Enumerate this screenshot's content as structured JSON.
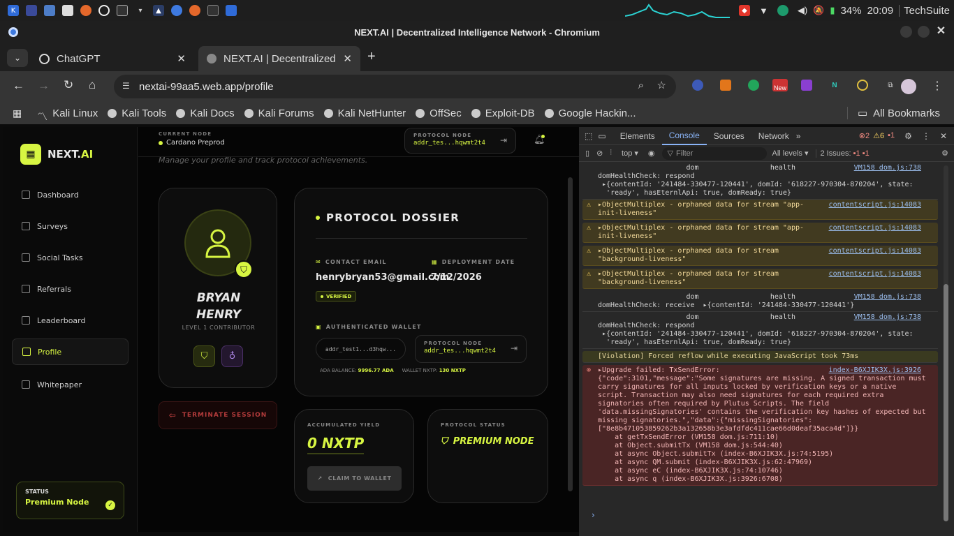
{
  "system": {
    "battery": "34%",
    "clock": "20:09",
    "user": "TechSuite"
  },
  "window": {
    "title": "NEXT.AI | Decentralized Intelligence Network - Chromium"
  },
  "tabs": [
    {
      "label": "ChatGPT"
    },
    {
      "label": "NEXT.AI | Decentralized I"
    }
  ],
  "address": {
    "url": "nextai-99aa5.web.app/profile"
  },
  "toolbar_ext": {
    "new_badge": "New"
  },
  "bookmarks": {
    "items": [
      "Kali Linux",
      "Kali Tools",
      "Kali Docs",
      "Kali Forums",
      "Kali NetHunter",
      "OffSec",
      "Exploit-DB",
      "Google Hackin..."
    ],
    "all": "All Bookmarks"
  },
  "app": {
    "brand": "NEXT.",
    "brand_accent": "AI",
    "nav": [
      "Dashboard",
      "Surveys",
      "Social Tasks",
      "Referrals",
      "Leaderboard",
      "Profile",
      "Whitepaper"
    ],
    "status_label": "STATUS",
    "status_value": "Premium Node",
    "current_node_label": "CURRENT NODE",
    "current_node": "Cardano Preprod",
    "protocol_node_label": "PROTOCOL NODE",
    "protocol_node_addr": "addr_tes...hqwmt2t4",
    "subtitle": "Manage your profile and track protocol achievements.",
    "user_first": "BRYAN",
    "user_last": "HENRY",
    "level": "LEVEL 1 CONTRIBUTOR",
    "terminate": "TERMINATE SESSION",
    "dossier_title": "PROTOCOL DOSSIER",
    "contact_label": "CONTACT EMAIL",
    "contact_value": "henrybryan53@gmail.com",
    "deploy_label": "DEPLOYMENT DATE",
    "deploy_value": "7/12/2026",
    "verified": "VERIFIED",
    "wallet_label": "AUTHENTICATED WALLET",
    "wallet_addr": "addr_test1...d3hqw...",
    "wallet_node_label": "PROTOCOL NODE",
    "wallet_node_addr": "addr_tes...hqwmt2t4",
    "ada_label": "ADA BALANCE:",
    "ada_value": "9996.77 ADA",
    "nxtp_label": "WALLET NXTP:",
    "nxtp_value": "130 NXTP",
    "yield_label": "ACCUMULATED YIELD",
    "yield_value": "0 NXTP",
    "claim": "CLAIM TO WALLET",
    "pstatus_label": "PROTOCOL STATUS",
    "pstatus_value": "PREMIUM NODE"
  },
  "devtools": {
    "tabs": [
      "Elements",
      "Console",
      "Sources",
      "Network"
    ],
    "errors": "2",
    "warnings": "6",
    "info": "1",
    "context": "top",
    "filter_placeholder": "Filter",
    "levels": "All levels",
    "issues": "2 Issues:",
    "issues_err": "1",
    "issues_info": "1"
  },
  "console": [
    {
      "type": "log",
      "text": "                     dom                 health\ndomHealthCheck: respond\n ▸{contentId: '241484-330477-120441', domId: '618227-970304-870204', state:\n  'ready', hasEternlApi: true, domReady: true}",
      "src": "VM158 dom.js:738"
    },
    {
      "type": "warn",
      "text": "▸ObjectMultiplex - orphaned data for stream \"app-\ninit-liveness\"",
      "src": "contentscript.js:14083"
    },
    {
      "type": "warn",
      "text": "▸ObjectMultiplex - orphaned data for stream \"app-\ninit-liveness\"",
      "src": "contentscript.js:14083"
    },
    {
      "type": "warn",
      "text": "▸ObjectMultiplex - orphaned data for stream\n\"background-liveness\"",
      "src": "contentscript.js:14083"
    },
    {
      "type": "warn",
      "text": "▸ObjectMultiplex - orphaned data for stream\n\"background-liveness\"",
      "src": "contentscript.js:14083"
    },
    {
      "type": "log",
      "text": "                     dom                 health\ndomHealthCheck: receive  ▸{contentId: '241484-330477-120441'}",
      "src": "VM158 dom.js:738"
    },
    {
      "type": "log",
      "text": "                     dom                 health\ndomHealthCheck: respond\n ▸{contentId: '241484-330477-120441', domId: '618227-970304-870204', state:\n  'ready', hasEternlApi: true, domReady: true}",
      "src": "VM158 dom.js:738"
    },
    {
      "type": "violation",
      "text": "[Violation] Forced reflow while executing JavaScript took 73ms",
      "src": ""
    },
    {
      "type": "err",
      "text": "▸Upgrade failed: TxSendError:\n{\"code\":3101,\"message\":\"Some signatures are missing. A signed transaction must\ncarry signatures for all inputs locked by verification keys or a native\nscript. Transaction may also need signatures for each required extra\nsignatories often required by Plutus Scripts. The field\n'data.missingSignatories' contains the verification key hashes of expected but\nmissing signatories.\",\"data\":{\"missingSignatories\":\n[\"8e8b471053859262b3a132658b3e3afdfdc411cae66d0deaf35aca4d\"]}}\n    at getTxSendError (VM158 dom.js:711:10)\n    at Object.submitTx (VM158 dom.js:544:40)\n    at async Object.submitTx (index-B6XJIK3X.js:74:5195)\n    at async QM.submit (index-B6XJIK3X.js:62:47969)\n    at async eC (index-B6XJIK3X.js:74:10746)\n    at async q (index-B6XJIK3X.js:3926:6708)",
      "src": "index-B6XJIK3X.js:3926"
    }
  ]
}
